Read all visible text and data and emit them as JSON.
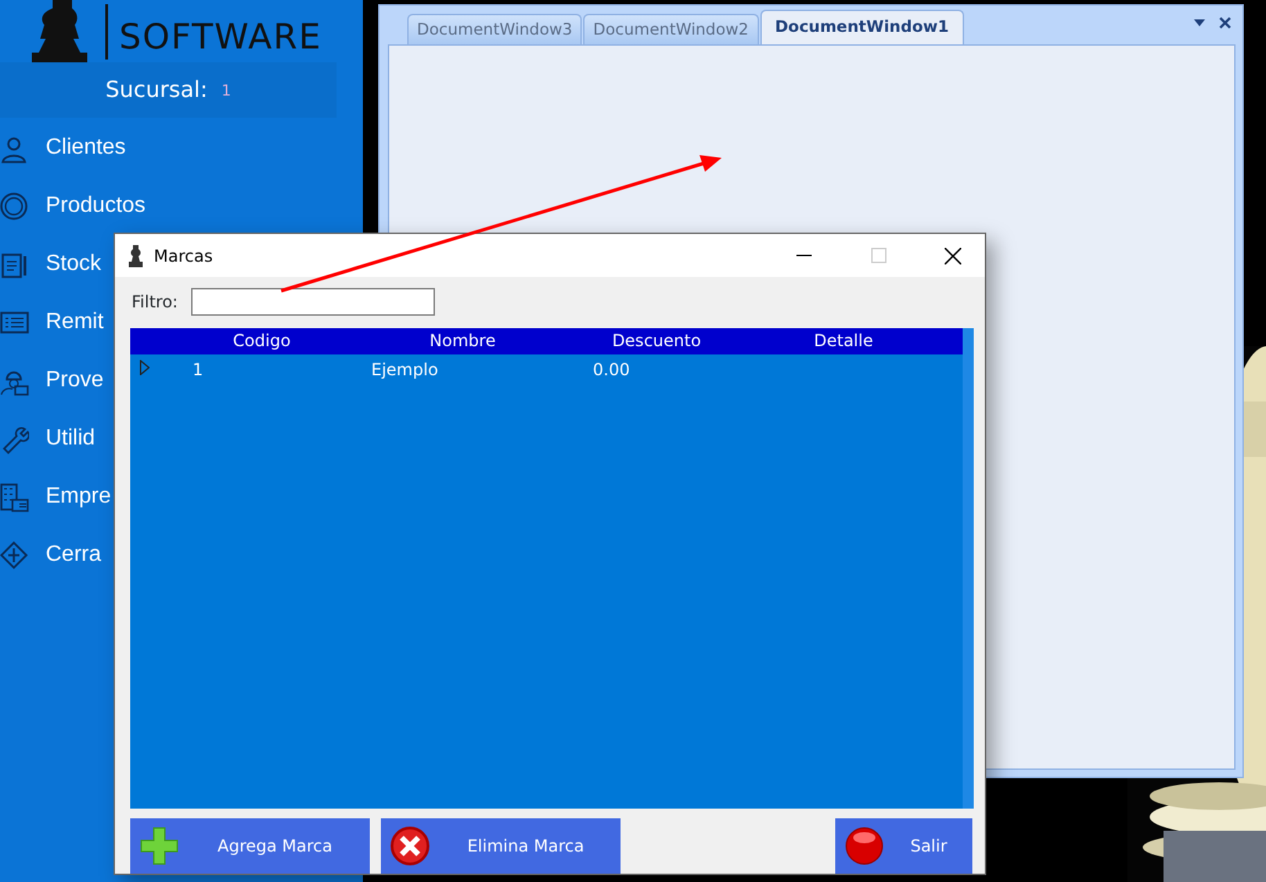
{
  "sidebar": {
    "logo_text": "SOFTWARE",
    "branch_label": "Sucursal:",
    "branch_value": "1",
    "items": [
      {
        "label": "Clientes",
        "kind": "users"
      },
      {
        "label": "Productos",
        "kind": "coin"
      },
      {
        "label": "Stock",
        "kind": "clipboard"
      },
      {
        "label": "Remit",
        "kind": "list"
      },
      {
        "label": "Prove",
        "kind": "worker"
      },
      {
        "label": "Utilid",
        "kind": "tools"
      },
      {
        "label": "Empre",
        "kind": "building"
      },
      {
        "label": "Cerra",
        "kind": "exit"
      }
    ]
  },
  "document_area": {
    "tabs": [
      {
        "label": "DocumentWindow3",
        "selected": false
      },
      {
        "label": "DocumentWindow2",
        "selected": false
      },
      {
        "label": "DocumentWindow1",
        "selected": true
      }
    ]
  },
  "marcas_window": {
    "title": "Marcas",
    "filter_label": "Filtro:",
    "columns": [
      "Codigo",
      "Nombre",
      "Descuento",
      "Detalle"
    ],
    "rows": [
      {
        "cells": [
          "1",
          "Ejemplo",
          "0.00"
        ],
        "current": true
      }
    ],
    "buttons": [
      {
        "label": "Agrega Marca",
        "kind": "add"
      },
      {
        "label": "Elimina Marca",
        "kind": "delete"
      },
      {
        "label": "Salir",
        "kind": "exit"
      }
    ]
  }
}
